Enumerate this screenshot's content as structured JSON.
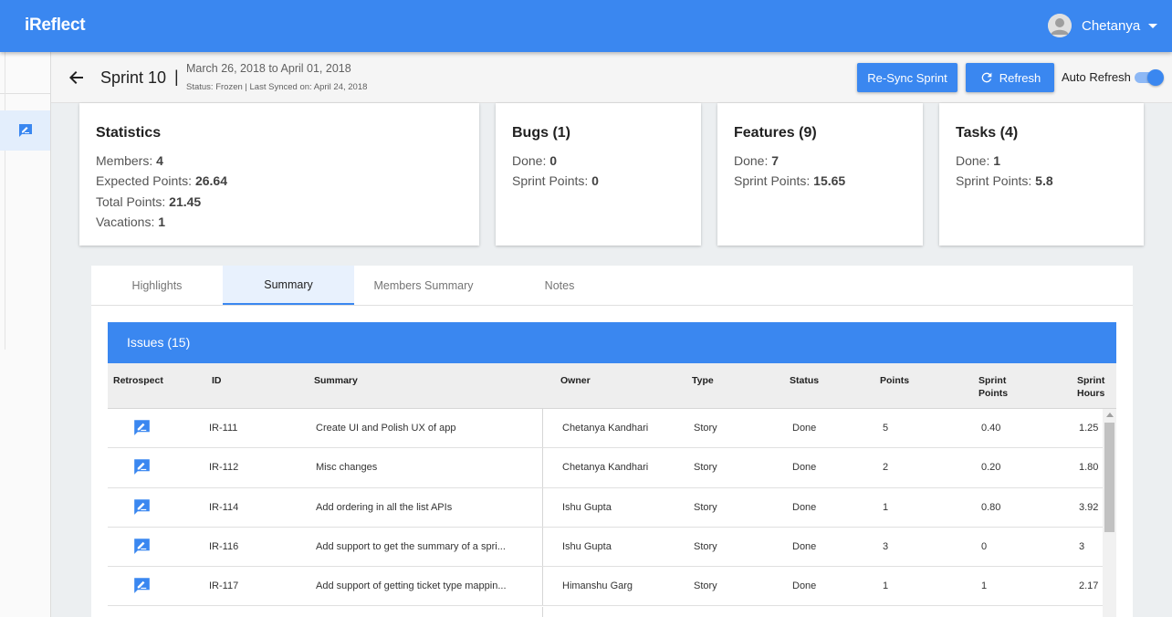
{
  "app": {
    "title": "iReflect"
  },
  "user": {
    "name": "Chetanya"
  },
  "sprint": {
    "title": "Sprint 10",
    "separator": "|",
    "dates": "March 26, 2018 to April 01, 2018",
    "status": "Status: Frozen | Last Synced on: April 24, 2018"
  },
  "actions": {
    "resync_label": "Re-Sync Sprint",
    "refresh_label": "Refresh",
    "auto_refresh_label": "Auto Refresh",
    "auto_refresh_on": true
  },
  "cards": {
    "statistics": {
      "title": "Statistics",
      "members_label": "Members: ",
      "members": "4",
      "expected_label": "Expected Points: ",
      "expected": "26.64",
      "total_label": "Total Points: ",
      "total": "21.45",
      "vacations_label": "Vacations: ",
      "vacations": "1"
    },
    "bugs": {
      "title": "Bugs (1)",
      "done_label": "Done: ",
      "done": "0",
      "points_label": "Sprint Points: ",
      "points": "0"
    },
    "features": {
      "title": "Features (9)",
      "done_label": "Done: ",
      "done": "7",
      "points_label": "Sprint Points: ",
      "points": "15.65"
    },
    "tasks": {
      "title": "Tasks (4)",
      "done_label": "Done: ",
      "done": "1",
      "points_label": "Sprint Points: ",
      "points": "5.8"
    }
  },
  "tabs": [
    {
      "label": "Highlights"
    },
    {
      "label": "Summary",
      "active": true
    },
    {
      "label": "Members Summary"
    },
    {
      "label": "Notes"
    }
  ],
  "issues": {
    "title": "Issues (15)",
    "columns": {
      "retrospect": "Retrospect",
      "id": "ID",
      "summary": "Summary",
      "owner": "Owner",
      "type": "Type",
      "status": "Status",
      "points": "Points",
      "sprint_points_1": "Sprint",
      "sprint_points_2": "Points",
      "sprint_hours_1": "Sprint",
      "sprint_hours_2": "Hours"
    },
    "rows": [
      {
        "id": "IR-111",
        "summary": "Create UI and Polish UX of app",
        "owner": "Chetanya Kandhari",
        "type": "Story",
        "status": "Done",
        "points": "5",
        "sprint_points": "0.40",
        "sprint_hours": "1.25"
      },
      {
        "id": "IR-112",
        "summary": "Misc changes",
        "owner": "Chetanya Kandhari",
        "type": "Story",
        "status": "Done",
        "points": "2",
        "sprint_points": "0.20",
        "sprint_hours": "1.80"
      },
      {
        "id": "IR-114",
        "summary": "Add ordering in all the list APIs",
        "owner": "Ishu Gupta",
        "type": "Story",
        "status": "Done",
        "points": "1",
        "sprint_points": "0.80",
        "sprint_hours": "3.92"
      },
      {
        "id": "IR-116",
        "summary": "Add support to get the summary of a spri...",
        "owner": "Ishu Gupta",
        "type": "Story",
        "status": "Done",
        "points": "3",
        "sprint_points": "0",
        "sprint_hours": "3"
      },
      {
        "id": "IR-117",
        "summary": "Add support of getting ticket type mappin...",
        "owner": "Himanshu Garg",
        "type": "Story",
        "status": "Done",
        "points": "1",
        "sprint_points": "1",
        "sprint_hours": "2.17"
      },
      {
        "id": "",
        "summary": "",
        "owner": "",
        "type": "",
        "status": "",
        "points": "",
        "sprint_points": "",
        "sprint_hours": ""
      }
    ]
  },
  "icons": {
    "back": "arrow-left-icon",
    "refresh": "refresh-icon",
    "retrospect": "edit-comment-icon",
    "user": "account-avatar-icon"
  },
  "colors": {
    "primary": "#3a87f0",
    "background": "#eceff1",
    "header_row": "#eeeeee"
  }
}
